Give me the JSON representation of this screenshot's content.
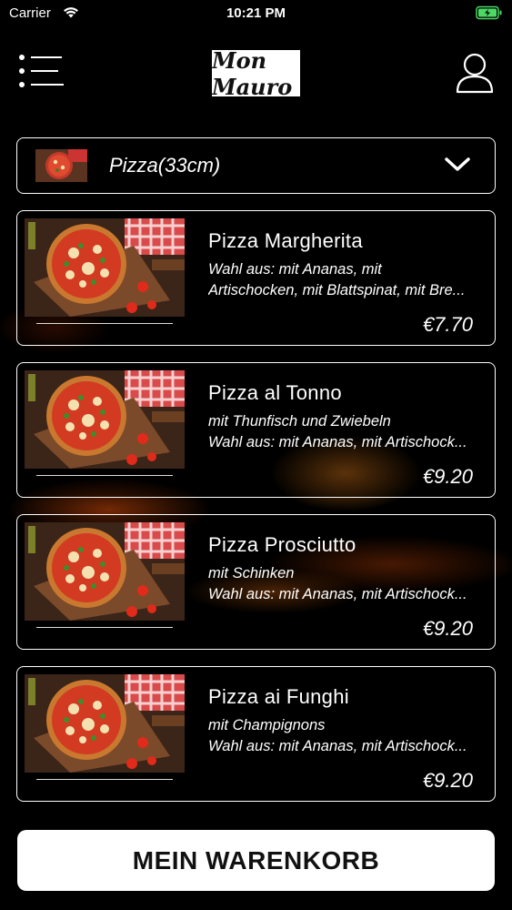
{
  "status_bar": {
    "carrier": "Carrier",
    "time": "10:21 PM"
  },
  "header": {
    "logo_text": "Mon Mauro"
  },
  "category": {
    "label": "Pizza(33cm)"
  },
  "products": [
    {
      "name": "Pizza Margherita",
      "desc_line1": "Wahl aus: mit Ananas, mit",
      "desc_line2": "Artischocken, mit Blattspinat, mit Bre...",
      "price": "€7.70"
    },
    {
      "name": "Pizza al Tonno",
      "desc_line1": "mit Thunfisch und Zwiebeln",
      "desc_line2": "Wahl aus: mit Ananas, mit Artischock...",
      "price": "€9.20"
    },
    {
      "name": " Pizza Prosciutto",
      "desc_line1": "mit Schinken",
      "desc_line2": "Wahl aus: mit Ananas, mit Artischock...",
      "price": "€9.20"
    },
    {
      "name": "Pizza ai Funghi",
      "desc_line1": "mit Champignons",
      "desc_line2": "Wahl aus: mit Ananas, mit Artischock...",
      "price": "€9.20"
    }
  ],
  "cart_button": {
    "label": "MEIN WARENKORB"
  },
  "colors": {
    "background": "#000000",
    "accent": "#ffffff",
    "battery": "#4cd964"
  },
  "icons": [
    "wifi-icon",
    "battery-icon",
    "menu-icon",
    "user-icon",
    "chevron-down-icon"
  ]
}
